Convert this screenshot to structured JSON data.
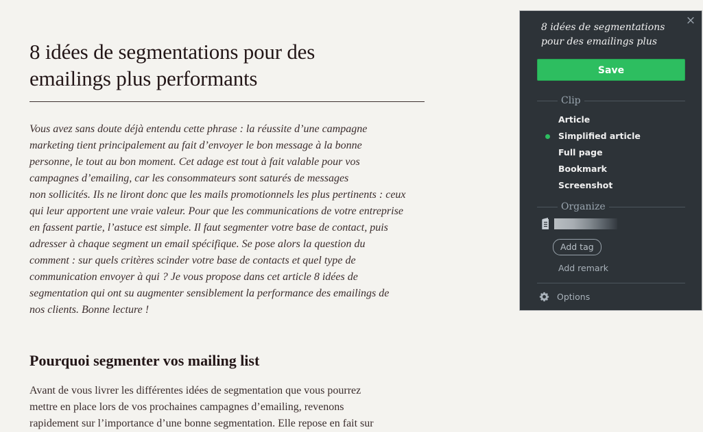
{
  "article": {
    "title_lines": [
      "8 idées de segmentations pour des",
      "emailings plus performants"
    ],
    "intro_lines": [
      "Vous avez sans doute déjà entendu cette phrase : la réussite d’une campagne",
      "marketing tient principalement au fait d’envoyer le bon message à la bonne",
      "personne, le tout au bon moment. Cet adage est tout à fait valable pour vos",
      "campagnes d’emailing, car les consommateurs sont saturés de messages",
      "non sollicités. Ils ne liront donc que les mails promotionnels les plus pertinents : ceux",
      "qui leur apportent une vraie valeur. Pour que les communications de votre entreprise",
      "en fassent partie, l’astuce est simple. Il faut segmenter votre base de contact, puis",
      "adresser à chaque segment un email spécifique. Se pose alors la question du",
      "comment : sur quels critères scinder votre base de contacts et quel type de",
      "communication envoyer à qui ? Je vous propose dans cet article 8 idées de",
      "segmentation qui ont su augmenter sensiblement la performance des emailings de",
      "nos clients. Bonne lecture !"
    ],
    "section_heading": "Pourquoi segmenter vos mailing list",
    "body_lines": [
      "Avant de vous livrer les différentes idées de segmentation que vous pourrez",
      "mettre en place lors de vos prochaines campagnes d’emailing, revenons",
      "rapidement sur l’importance d’une bonne segmentation. Elle repose en fait sur"
    ]
  },
  "clipper": {
    "close_icon": "×",
    "title": "8 idées de segmentations pour des emailings plus",
    "save_label": "Save",
    "clip_section_label": "Clip",
    "clip_options": [
      {
        "label": "Article",
        "selected": false
      },
      {
        "label": "Simplified article",
        "selected": true
      },
      {
        "label": "Full page",
        "selected": false
      },
      {
        "label": "Bookmark",
        "selected": false
      },
      {
        "label": "Screenshot",
        "selected": false
      }
    ],
    "organize_section_label": "Organize",
    "notebook_name_redacted": true,
    "add_tag_label": "Add tag",
    "add_remark_label": "Add remark",
    "options_label": "Options",
    "colors": {
      "panel_bg": "#2d3338",
      "accent_green": "#2dbe60",
      "page_bg": "#f4f3ef"
    }
  }
}
